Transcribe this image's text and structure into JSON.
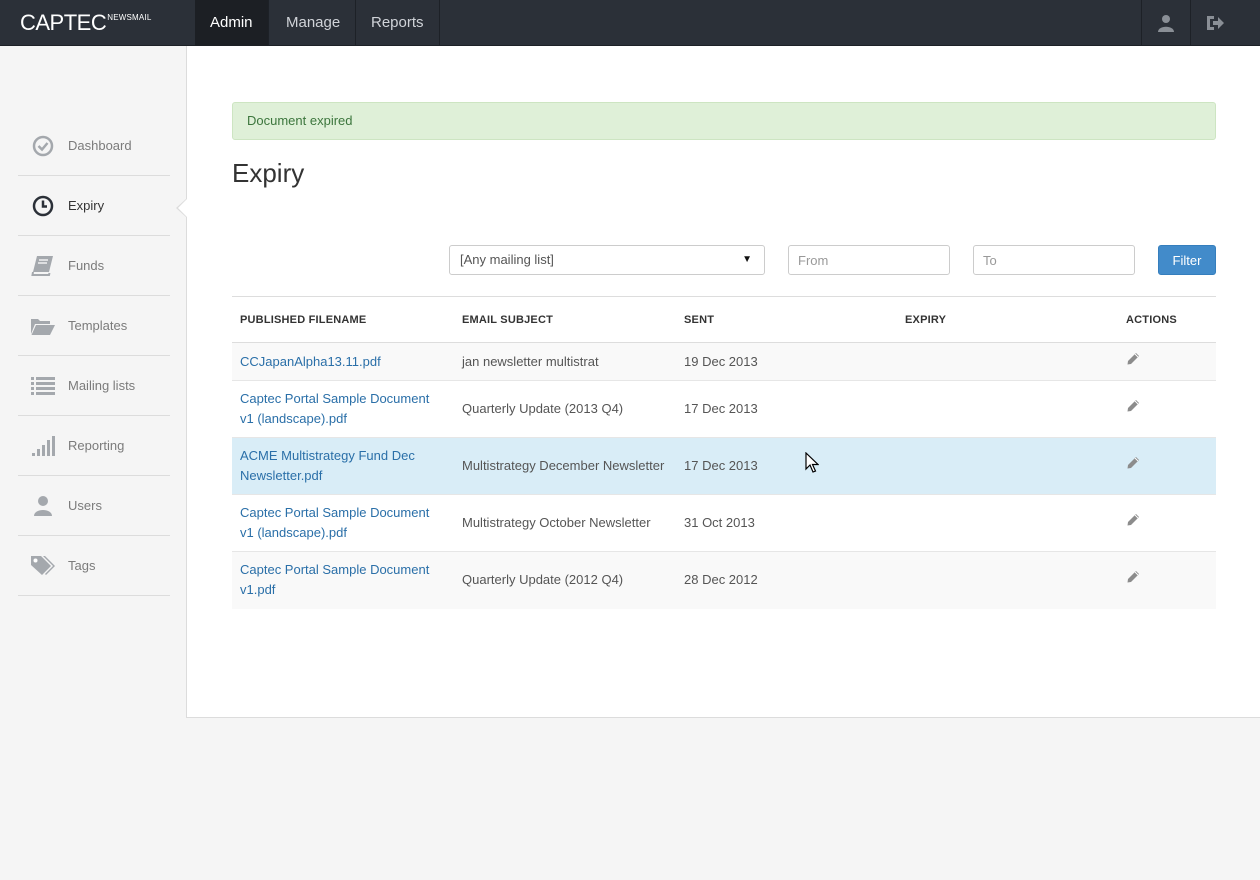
{
  "brand": {
    "name": "CAPTEC",
    "sub": "NEWSMAIL"
  },
  "nav": {
    "tabs": [
      {
        "label": "Admin",
        "active": true
      },
      {
        "label": "Manage",
        "active": false
      },
      {
        "label": "Reports",
        "active": false
      }
    ],
    "right_icons": [
      "user-icon",
      "logout-icon"
    ]
  },
  "sidebar": {
    "items": [
      {
        "label": "Dashboard",
        "icon": "check-circle-icon",
        "active": false
      },
      {
        "label": "Expiry",
        "icon": "clock-icon",
        "active": true
      },
      {
        "label": "Funds",
        "icon": "book-icon",
        "active": false
      },
      {
        "label": "Templates",
        "icon": "folder-open-icon",
        "active": false
      },
      {
        "label": "Mailing lists",
        "icon": "list-icon",
        "active": false
      },
      {
        "label": "Reporting",
        "icon": "signal-bars-icon",
        "active": false
      },
      {
        "label": "Users",
        "icon": "user-icon",
        "active": false
      },
      {
        "label": "Tags",
        "icon": "tags-icon",
        "active": false
      }
    ]
  },
  "alert": {
    "text": "Document expired"
  },
  "page": {
    "title": "Expiry"
  },
  "filters": {
    "mailing_list": "[Any mailing list]",
    "from_placeholder": "From",
    "to_placeholder": "To",
    "filter_label": "Filter"
  },
  "table": {
    "headers": [
      "PUBLISHED FILENAME",
      "EMAIL SUBJECT",
      "SENT",
      "EXPIRY",
      "ACTIONS"
    ],
    "rows": [
      {
        "filename": "CCJapanAlpha13.11.pdf",
        "subject": "jan newsletter multistrat",
        "sent": "19 Dec 2013",
        "expiry": ""
      },
      {
        "filename": "Captec Portal Sample Document v1 (landscape).pdf",
        "subject": "Quarterly Update (2013 Q4)",
        "sent": "17 Dec 2013",
        "expiry": ""
      },
      {
        "filename": "ACME Multistrategy Fund Dec Newsletter.pdf",
        "subject": "Multistrategy December Newsletter",
        "sent": "17 Dec 2013",
        "expiry": ""
      },
      {
        "filename": "Captec Portal Sample Document v1 (landscape).pdf",
        "subject": "Multistrategy October Newsletter",
        "sent": "31 Oct 2013",
        "expiry": ""
      },
      {
        "filename": "Captec Portal Sample Document v1.pdf",
        "subject": "Quarterly Update (2012 Q4)",
        "sent": "28 Dec 2012",
        "expiry": ""
      }
    ]
  },
  "colors": {
    "navbar": "#2b3038",
    "accent": "#428bca",
    "alert_bg": "#dff0d8",
    "row_hover": "#d9edf7",
    "link": "#2a6fa8"
  }
}
